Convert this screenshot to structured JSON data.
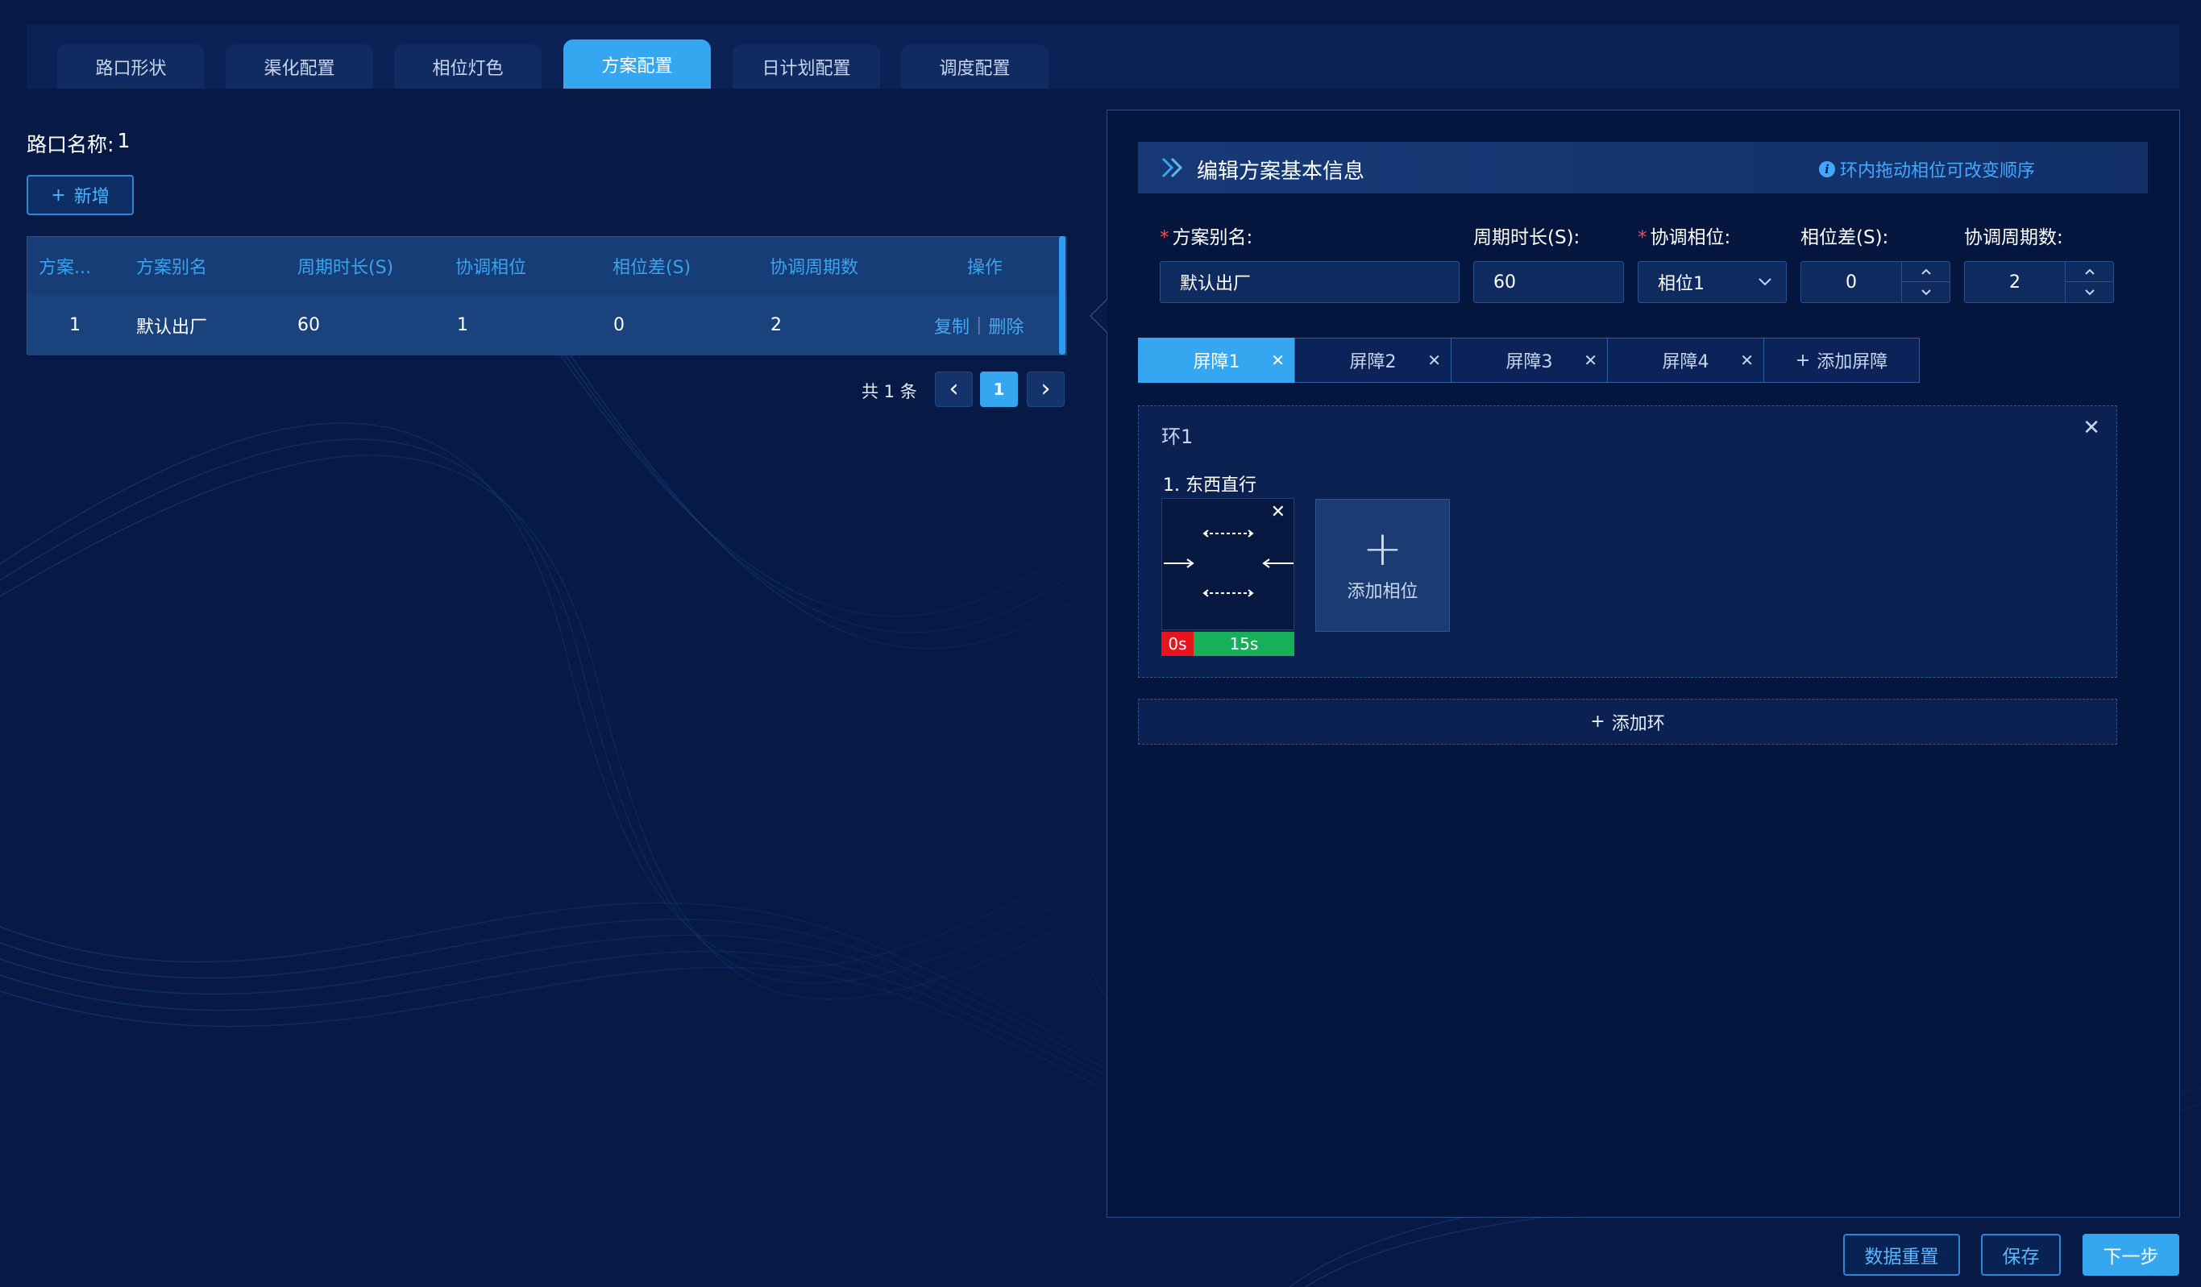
{
  "tabs": [
    {
      "label": "路口形状",
      "active": false
    },
    {
      "label": "渠化配置",
      "active": false
    },
    {
      "label": "相位灯色",
      "active": false
    },
    {
      "label": "方案配置",
      "active": true
    },
    {
      "label": "日计划配置",
      "active": false
    },
    {
      "label": "调度配置",
      "active": false
    }
  ],
  "left": {
    "crossing_label": "路口名称:",
    "crossing_value": "1",
    "add_button": "新增",
    "add_icon": "+",
    "table": {
      "headers": [
        "方案...",
        "方案别名",
        "周期时长(S)",
        "协调相位",
        "相位差(S)",
        "协调周期数",
        "操作"
      ],
      "rows": [
        {
          "no": "1",
          "alias": "默认出厂",
          "cycle": "60",
          "coord_phase": "1",
          "offset": "0",
          "coord_cycles": "2",
          "op_copy": "复制",
          "op_sep": "|",
          "op_delete": "删除"
        }
      ]
    },
    "pager": {
      "total": "共 1 条",
      "prev": "‹",
      "page": "1",
      "next": "›"
    }
  },
  "right": {
    "section_title": "编辑方案基本信息",
    "hint": "环内拖动相位可改变顺序",
    "hint_icon": "i",
    "form": {
      "alias_label": "方案别名:",
      "alias_value": "默认出厂",
      "cycle_label": "周期时长(S):",
      "cycle_value": "60",
      "coord_phase_label": "协调相位:",
      "coord_phase_value": "相位1",
      "offset_label": "相位差(S):",
      "offset_value": "0",
      "coord_cycles_label": "协调周期数:",
      "coord_cycles_value": "2",
      "required_mark": "*"
    },
    "barriers": [
      "屏障1",
      "屏障2",
      "屏障3",
      "屏障4"
    ],
    "add_barrier": "添加屏障",
    "ring": {
      "title": "环1",
      "phase_label": "1. 东西直行",
      "red_time": "0s",
      "green_time": "15s",
      "add_phase": "添加相位"
    },
    "add_ring": "添加环"
  },
  "footer": {
    "reset": "数据重置",
    "save": "保存",
    "next": "下一步"
  },
  "colors": {
    "accent": "#35a7f0",
    "background": "#061a45",
    "red": "#e8141d",
    "green": "#17b058"
  }
}
